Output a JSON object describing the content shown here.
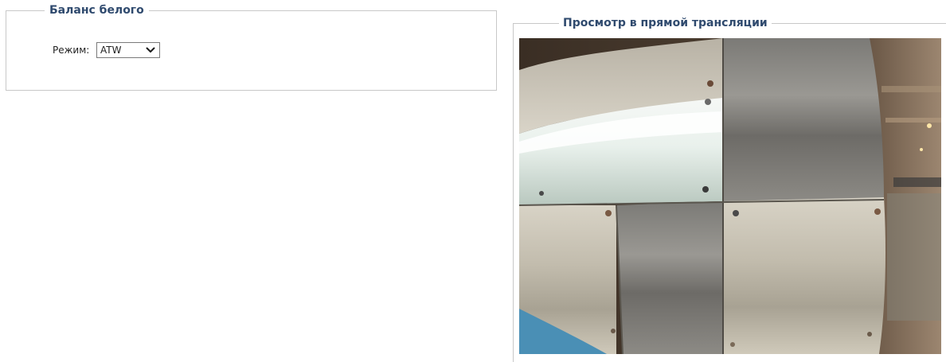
{
  "white_balance": {
    "legend": "Баланс белого",
    "mode_label": "Режим:",
    "mode_value": "ATW"
  },
  "live_view": {
    "legend": "Просмотр в прямой трансляции",
    "image_icon": "camera-live-feed"
  }
}
